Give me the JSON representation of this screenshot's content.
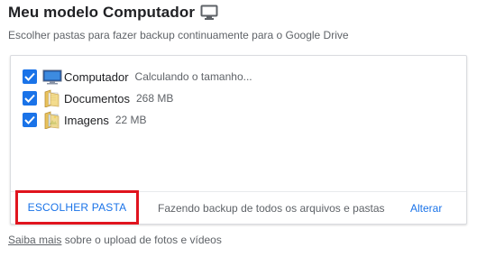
{
  "header": {
    "title": "Meu modelo Computador",
    "title_icon": "monitor-icon",
    "subtitle": "Escolher pastas para fazer backup continuamente para o Google Drive"
  },
  "folders": [
    {
      "name": "Computador",
      "detail": "Calculando o tamanho...",
      "checked": true,
      "icon": "computer-icon"
    },
    {
      "name": "Documentos",
      "detail": "268 MB",
      "checked": true,
      "icon": "folder-icon"
    },
    {
      "name": "Imagens",
      "detail": "22 MB",
      "checked": true,
      "icon": "folder-images-icon"
    }
  ],
  "footer": {
    "choose_label": "ESCOLHER PASTA",
    "status": "Fazendo backup de todos os arquivos e pastas",
    "change_label": "Alterar"
  },
  "bottom": {
    "link_label": "Saiba mais",
    "text": "sobre o upload de fotos e vídeos"
  },
  "colors": {
    "accent": "#1a73e8",
    "highlight_border": "#e0141e"
  }
}
